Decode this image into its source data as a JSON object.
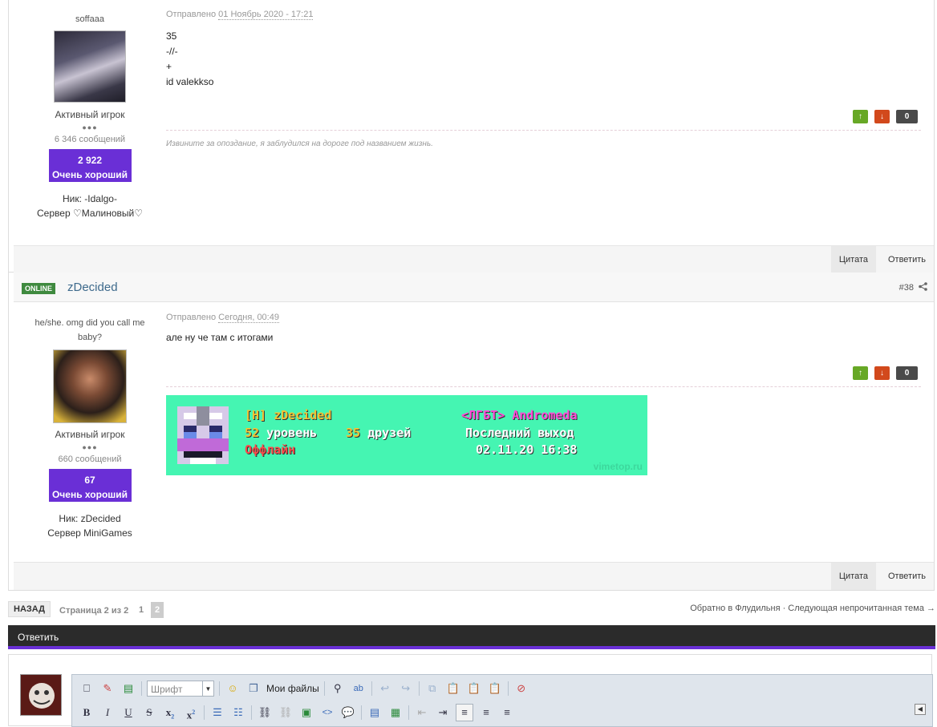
{
  "post1": {
    "username": "soffaaa",
    "role": "Активный игрок",
    "dots": "●●●",
    "messages": "6 346 сообщений",
    "rep_value": "2 922",
    "rep_label": "Очень хороший",
    "nick": "Ник: -Idalgo-",
    "server": "Сервер ♡Малиновый♡",
    "meta_prefix": "Отправлено",
    "meta_date": "01 Ноябрь 2020 - 17:21",
    "lines": [
      "35",
      "-//-",
      "+",
      "id valekkso"
    ],
    "up": "↑",
    "down": "↓",
    "score": "0",
    "signature": "Извините за опоздание, я заблудился на дороге под названием жизнь.",
    "quote": "Цитата",
    "reply": "Ответить"
  },
  "post2": {
    "status": "ONLINE",
    "header_name": "zDecided",
    "post_number": "#38",
    "share_icon": "share-icon",
    "user_title": "he/she. omg did you call me baby?",
    "role": "Активный игрок",
    "dots": "●●●",
    "messages": "660 сообщений",
    "rep_value": "67",
    "rep_label": "Очень хороший",
    "nick": "Ник: zDecided",
    "server": "Сервер MiniGames",
    "meta_prefix": "Отправлено",
    "meta_date": "Сегодня, 00:49",
    "text": "але ну че там с итогами",
    "up": "↑",
    "down": "↓",
    "score": "0",
    "banner": {
      "name": "[H] zDecided",
      "level": "52",
      "level_label": "уровень",
      "friends": "35",
      "friends_label": "друзей",
      "status": "Оффлайн",
      "guild": "<ЛГБТ> Andromeda",
      "last_seen_label": "Последний выход",
      "last_seen": "02.11.20 16:38",
      "watermark": "vimetop.ru"
    },
    "quote": "Цитата",
    "reply": "Ответить"
  },
  "pagination": {
    "back": "НАЗАД",
    "label": "Страница 2 из 2",
    "pages": [
      "1",
      "2"
    ],
    "crumbs": "Обратно в Флудильня · Следующая непрочитанная тема →"
  },
  "reply_box": {
    "title": "Ответить",
    "font_placeholder": "Шрифт",
    "my_files": "Мои файлы"
  },
  "colors": {
    "accent": "#6a2fd6",
    "online": "#3f8a3f",
    "vote_up": "#67a826",
    "vote_down": "#d2491c",
    "banner_bg": "#45f5b2"
  }
}
